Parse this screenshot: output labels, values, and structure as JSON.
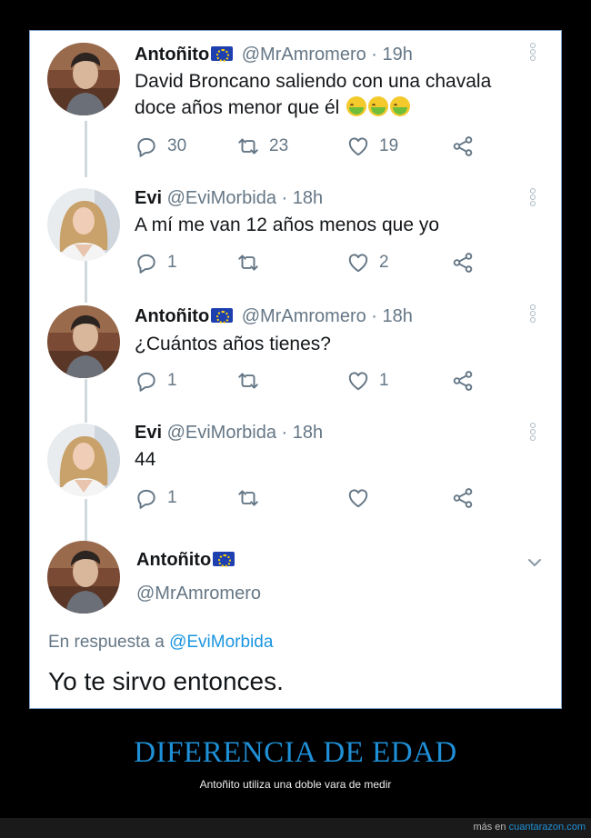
{
  "tweets": [
    {
      "name": "Antoñito",
      "handle": "@MrAmromero",
      "time": "· 19h",
      "text": "David Broncano saliendo con una chavala doce años menor que él",
      "text_line1": "David Broncano saliendo con una chavala",
      "text_line2": "doce años menor que él",
      "replies": "30",
      "retweets": "23",
      "likes": "19"
    },
    {
      "name": "Evi",
      "handle": "@EviMorbida",
      "time": "· 18h",
      "text": "A mí me van 12 años menos que yo",
      "replies": "1",
      "retweets": "",
      "likes": "2"
    },
    {
      "name": "Antoñito",
      "handle": "@MrAmromero",
      "time": "· 18h",
      "text": "¿Cuántos años tienes?",
      "replies": "1",
      "retweets": "",
      "likes": "1"
    },
    {
      "name": "Evi",
      "handle": "@EviMorbida",
      "time": "· 18h",
      "text": "44",
      "replies": "1",
      "retweets": "",
      "likes": ""
    }
  ],
  "main_tweet": {
    "name": "Antoñito",
    "handle": "@MrAmromero",
    "reply_prefix": "En respuesta a",
    "reply_handle": "@EviMorbida",
    "text": "Yo te sirvo entonces."
  },
  "caption": {
    "title": "DIFERENCIA DE EDAD",
    "subtitle": "Antoñito utiliza una doble vara de medir"
  },
  "footer": {
    "prefix": "más en",
    "site": "cuantarazon.com"
  },
  "icons": {
    "reply": "reply-icon",
    "retweet": "retweet-icon",
    "like": "heart-icon",
    "share": "share-icon",
    "more": "more-vertical-icon",
    "flag": "eu-flag-icon",
    "emoji": "nauseated-face-emoji-icon",
    "chevron": "chevron-down-icon"
  },
  "colors": {
    "link": "#1b95e0",
    "caption": "#1f8fd6",
    "muted": "#657786"
  }
}
